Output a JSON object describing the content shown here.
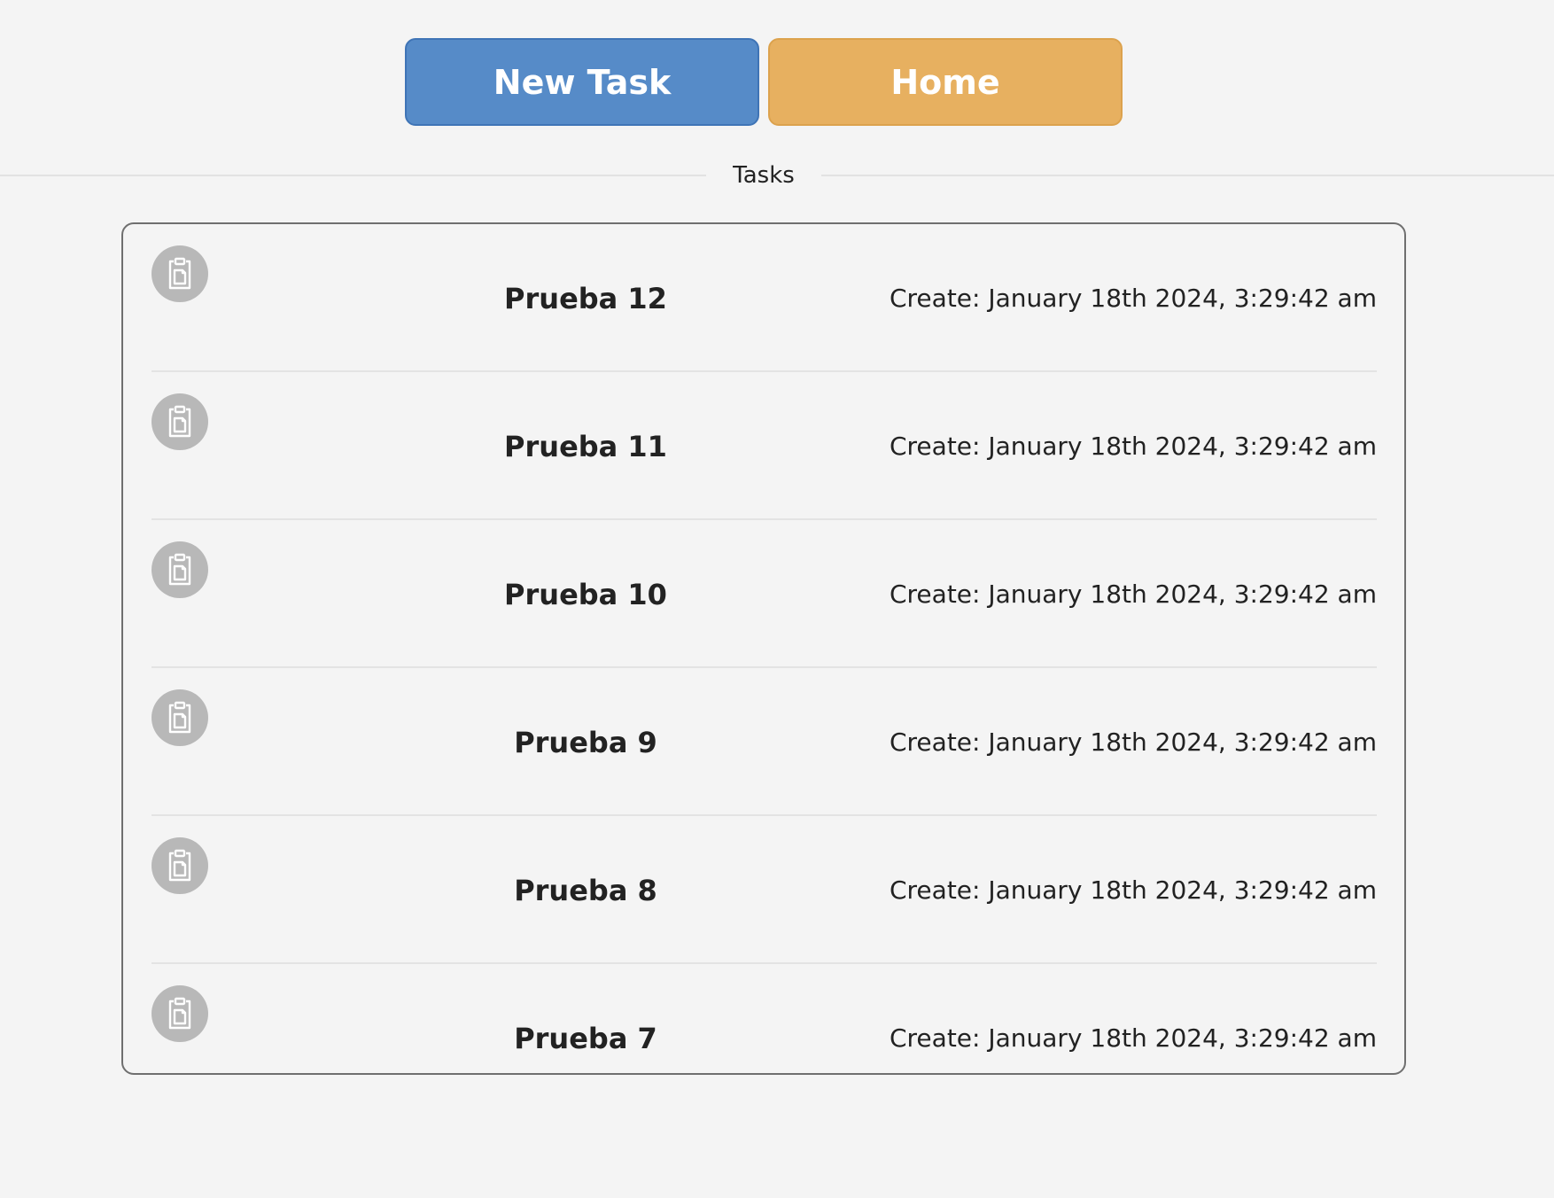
{
  "toolbar": {
    "new_task_label": "New Task",
    "home_label": "Home",
    "new_task_color": "#568bc8",
    "home_color": "#e7b060"
  },
  "section": {
    "title": "Tasks"
  },
  "tasks": [
    {
      "title": "Prueba 12",
      "created": "Create: January 18th 2024, 3:29:42 am",
      "icon": "clipboard-icon"
    },
    {
      "title": "Prueba 11",
      "created": "Create: January 18th 2024, 3:29:42 am",
      "icon": "clipboard-icon"
    },
    {
      "title": "Prueba 10",
      "created": "Create: January 18th 2024, 3:29:42 am",
      "icon": "clipboard-icon"
    },
    {
      "title": "Prueba 9",
      "created": "Create: January 18th 2024, 3:29:42 am",
      "icon": "clipboard-icon"
    },
    {
      "title": "Prueba 8",
      "created": "Create: January 18th 2024, 3:29:42 am",
      "icon": "clipboard-icon"
    },
    {
      "title": "Prueba 7",
      "created": "Create: January 18th 2024, 3:29:42 am",
      "icon": "clipboard-icon"
    }
  ]
}
